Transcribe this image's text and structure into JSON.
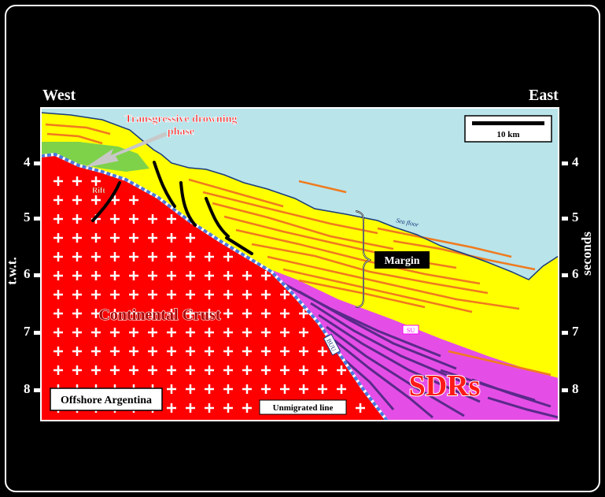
{
  "directions": {
    "west": "West",
    "east": "East"
  },
  "axis": {
    "left_label": "t.w.t.",
    "right_label": "seconds",
    "ticks": [
      "4",
      "5",
      "6",
      "7",
      "8"
    ]
  },
  "labels": {
    "transgressive_line1": "Transgressive drowning",
    "transgressive_line2": "phase",
    "rift": "Rift",
    "sea_floor": "Sea floor",
    "margin": "Margin",
    "continental_crust": "Continental Crust",
    "su": "SU",
    "buu": "BUU",
    "sdrs": "SDRs",
    "offshore": "Offshore Argentina",
    "unmigrated": "Unmigrated line",
    "scale": "10 km"
  },
  "colors": {
    "background": "#000000",
    "sea": "#b8e4ea",
    "crust": "#ff0000",
    "margin": "#ffff00",
    "sdrs": "#e54ee6",
    "green": "#7ed24a",
    "rift": "#ff9a2a",
    "reflector": "#f07a1e",
    "sdr_line": "#5a2a8a",
    "unconformity": "#4a78e0"
  }
}
